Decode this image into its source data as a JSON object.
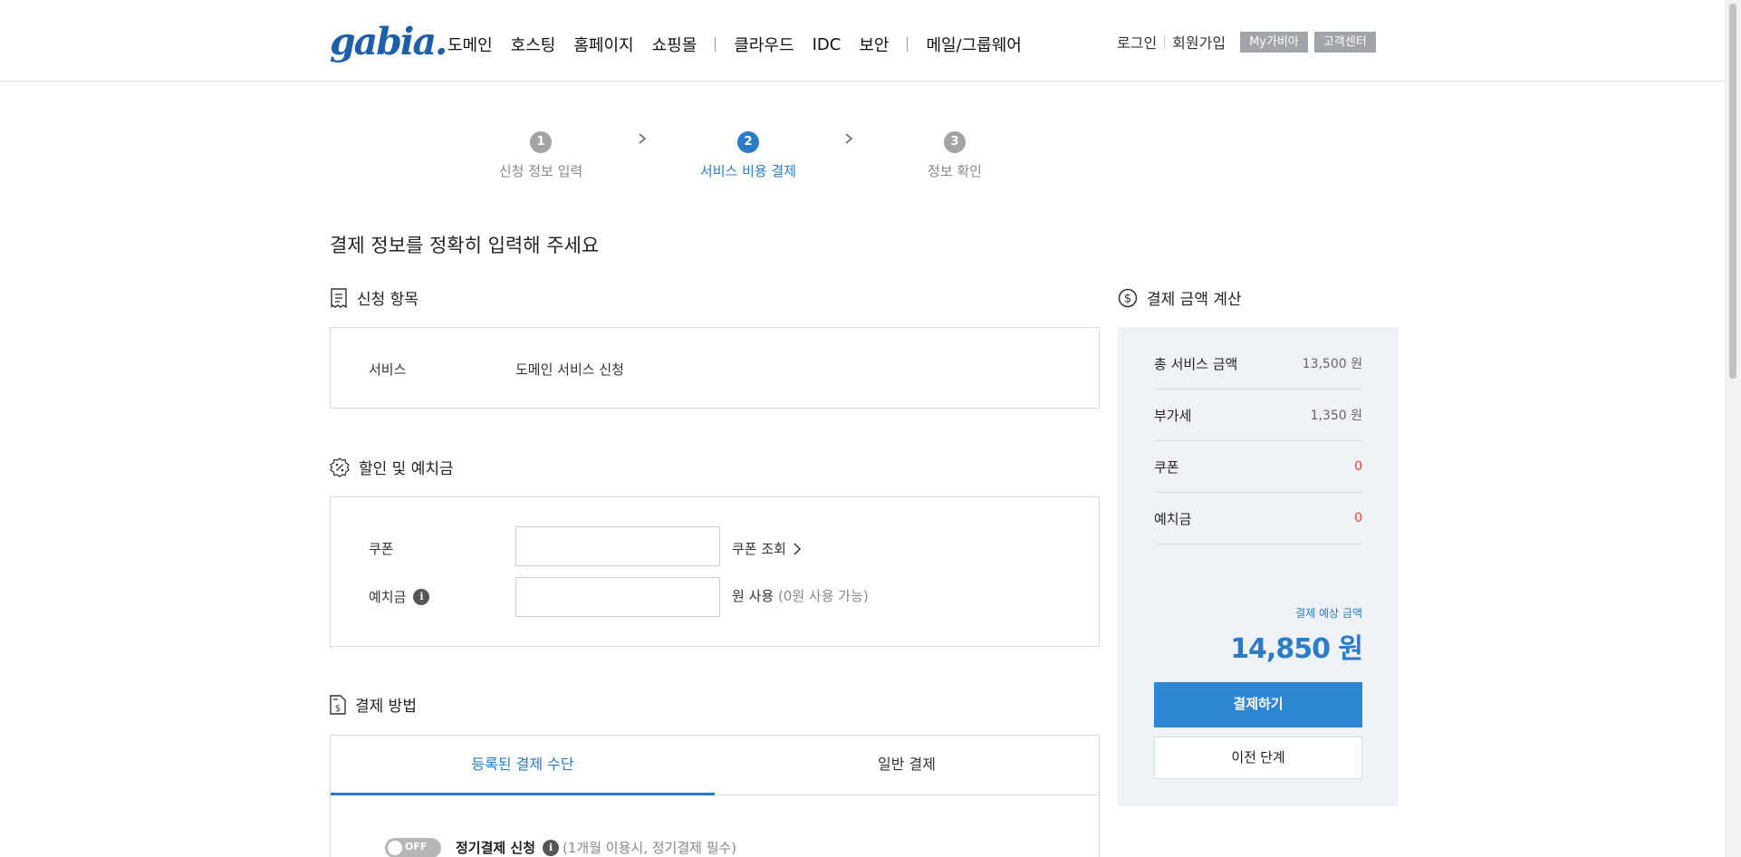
{
  "header": {
    "logo": "gabia.",
    "nav": [
      "도메인",
      "호스팅",
      "홈페이지",
      "쇼핑몰",
      "클라우드",
      "IDC",
      "보안",
      "메일/그룹웨어"
    ],
    "login": "로그인",
    "signup": "회원가입",
    "mygabia": "My가비아",
    "support": "고객센터"
  },
  "steps": [
    {
      "num": "1",
      "label": "신청 정보 입력",
      "active": false
    },
    {
      "num": "2",
      "label": "서비스 비용 결제",
      "active": true
    },
    {
      "num": "3",
      "label": "정보 확인",
      "active": false
    }
  ],
  "page_title": "결제 정보를 정확히 입력해 주세요",
  "application": {
    "title": "신청 항목",
    "service_label": "서비스",
    "service_value": "도메인 서비스 신청"
  },
  "discount": {
    "title": "할인 및 예치금",
    "coupon_label": "쿠폰",
    "coupon_value": "",
    "coupon_lookup": "쿠폰 조회",
    "deposit_label": "예치금",
    "deposit_value": "",
    "deposit_unit": "원 사용",
    "deposit_hint": "(0원 사용 가능)"
  },
  "payment_method": {
    "title": "결제 방법",
    "tabs": [
      "등록된 결제 수단",
      "일반 결제"
    ],
    "toggle_state": "OFF",
    "recurring_label": "정기결제 신청",
    "recurring_hint": "(1개월 이용시, 정기결제 필수)"
  },
  "summary": {
    "title": "결제 금액 계산",
    "rows": [
      {
        "label": "총 서비스 금액",
        "value": "13,500 원",
        "red": false
      },
      {
        "label": "부가세",
        "value": "1,350 원",
        "red": false
      },
      {
        "label": "쿠폰",
        "value": "0",
        "red": true
      },
      {
        "label": "예치금",
        "value": "0",
        "red": true
      }
    ],
    "expected_label": "결제 예상 금액",
    "expected_value": "14,850 원",
    "pay_button": "결제하기",
    "prev_button": "이전 단계"
  },
  "colors": {
    "accent": "#2b7bc8",
    "pay_button": "#2f86d3",
    "summary_bg": "#eef2f7",
    "negative": "#e0453a"
  }
}
